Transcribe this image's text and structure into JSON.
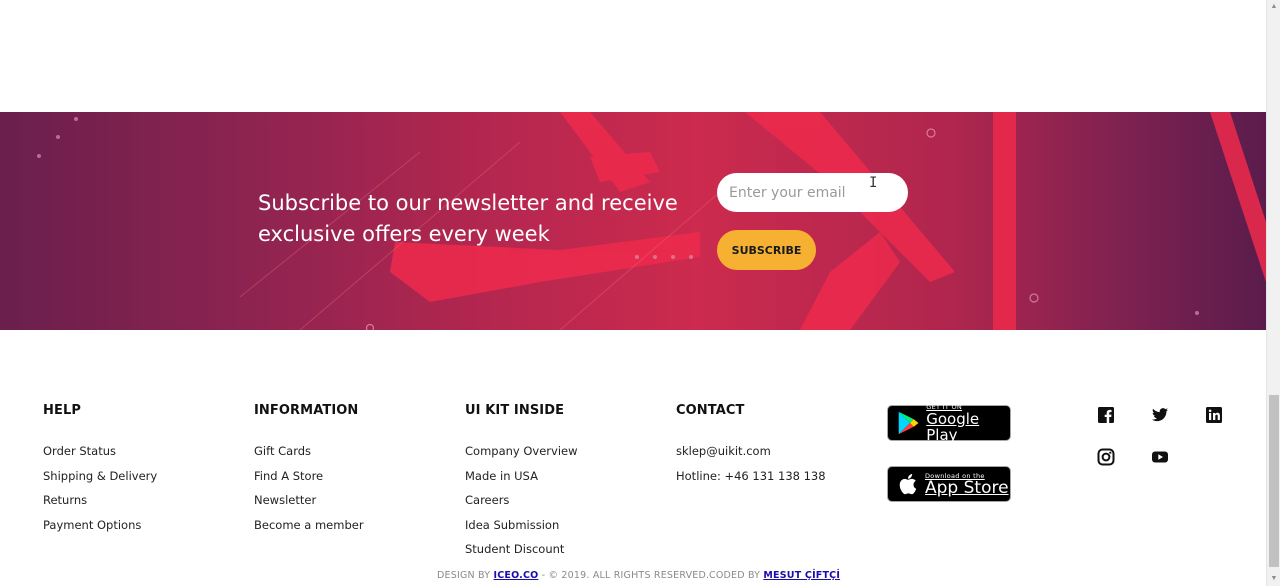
{
  "newsletter": {
    "title": "Subscribe to our newsletter and receive exclusive offers every week",
    "email_placeholder": "Enter your email",
    "email_value": "",
    "subscribe_label": "SUBSCRIBE"
  },
  "footer": {
    "columns": [
      {
        "title": "HELP",
        "items": [
          "Order Status",
          "Shipping & Delivery",
          "Returns",
          "Payment Options"
        ]
      },
      {
        "title": "INFORMATION",
        "items": [
          "Gift Cards",
          "Find A Store",
          "Newsletter",
          "Become a member"
        ]
      },
      {
        "title": "UI KIT INSIDE",
        "items": [
          "Company Overview",
          "Made in USA",
          "Careers",
          "Idea Submission",
          "Student Discount"
        ]
      },
      {
        "title": "CONTACT",
        "items": [
          "sklep@uikit.com",
          "Hotline: +46 131 138 138"
        ]
      }
    ],
    "google_play": {
      "small": "GET IT ON",
      "big": "Google Play"
    },
    "app_store": {
      "small": "Download on the",
      "big": "App Store"
    },
    "social_icons": [
      "facebook-icon",
      "twitter-icon",
      "linkedin-icon",
      "instagram-icon",
      "youtube-icon"
    ],
    "credits": {
      "design_prefix": "DESIGN BY",
      "design_link": "ICEO.CO",
      "design_suffix": "- © 2019. ALL RIGHTS RESERVED.",
      "coded_prefix": "CODED BY",
      "coded_link": "MESUT ÇİFTÇİ"
    }
  },
  "colors": {
    "accent_button": "#f6b132",
    "banner_primary": "#cc2a4e",
    "banner_dark": "#6a1f4d",
    "link": "#1a0dab"
  }
}
